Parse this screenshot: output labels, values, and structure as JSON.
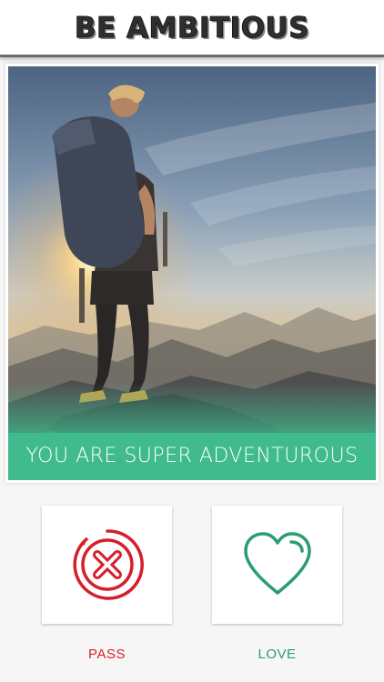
{
  "header": {
    "title": "BE AMBITIOUS"
  },
  "card": {
    "caption": "YOU ARE SUPER ADVENTUROUS",
    "caption_color": "#3fbb8d"
  },
  "actions": {
    "pass": {
      "label": "PASS",
      "icon": "x-circle-icon",
      "color": "#d71f2b"
    },
    "love": {
      "label": "LOVE",
      "icon": "heart-icon",
      "color": "#2a9d6f"
    }
  }
}
